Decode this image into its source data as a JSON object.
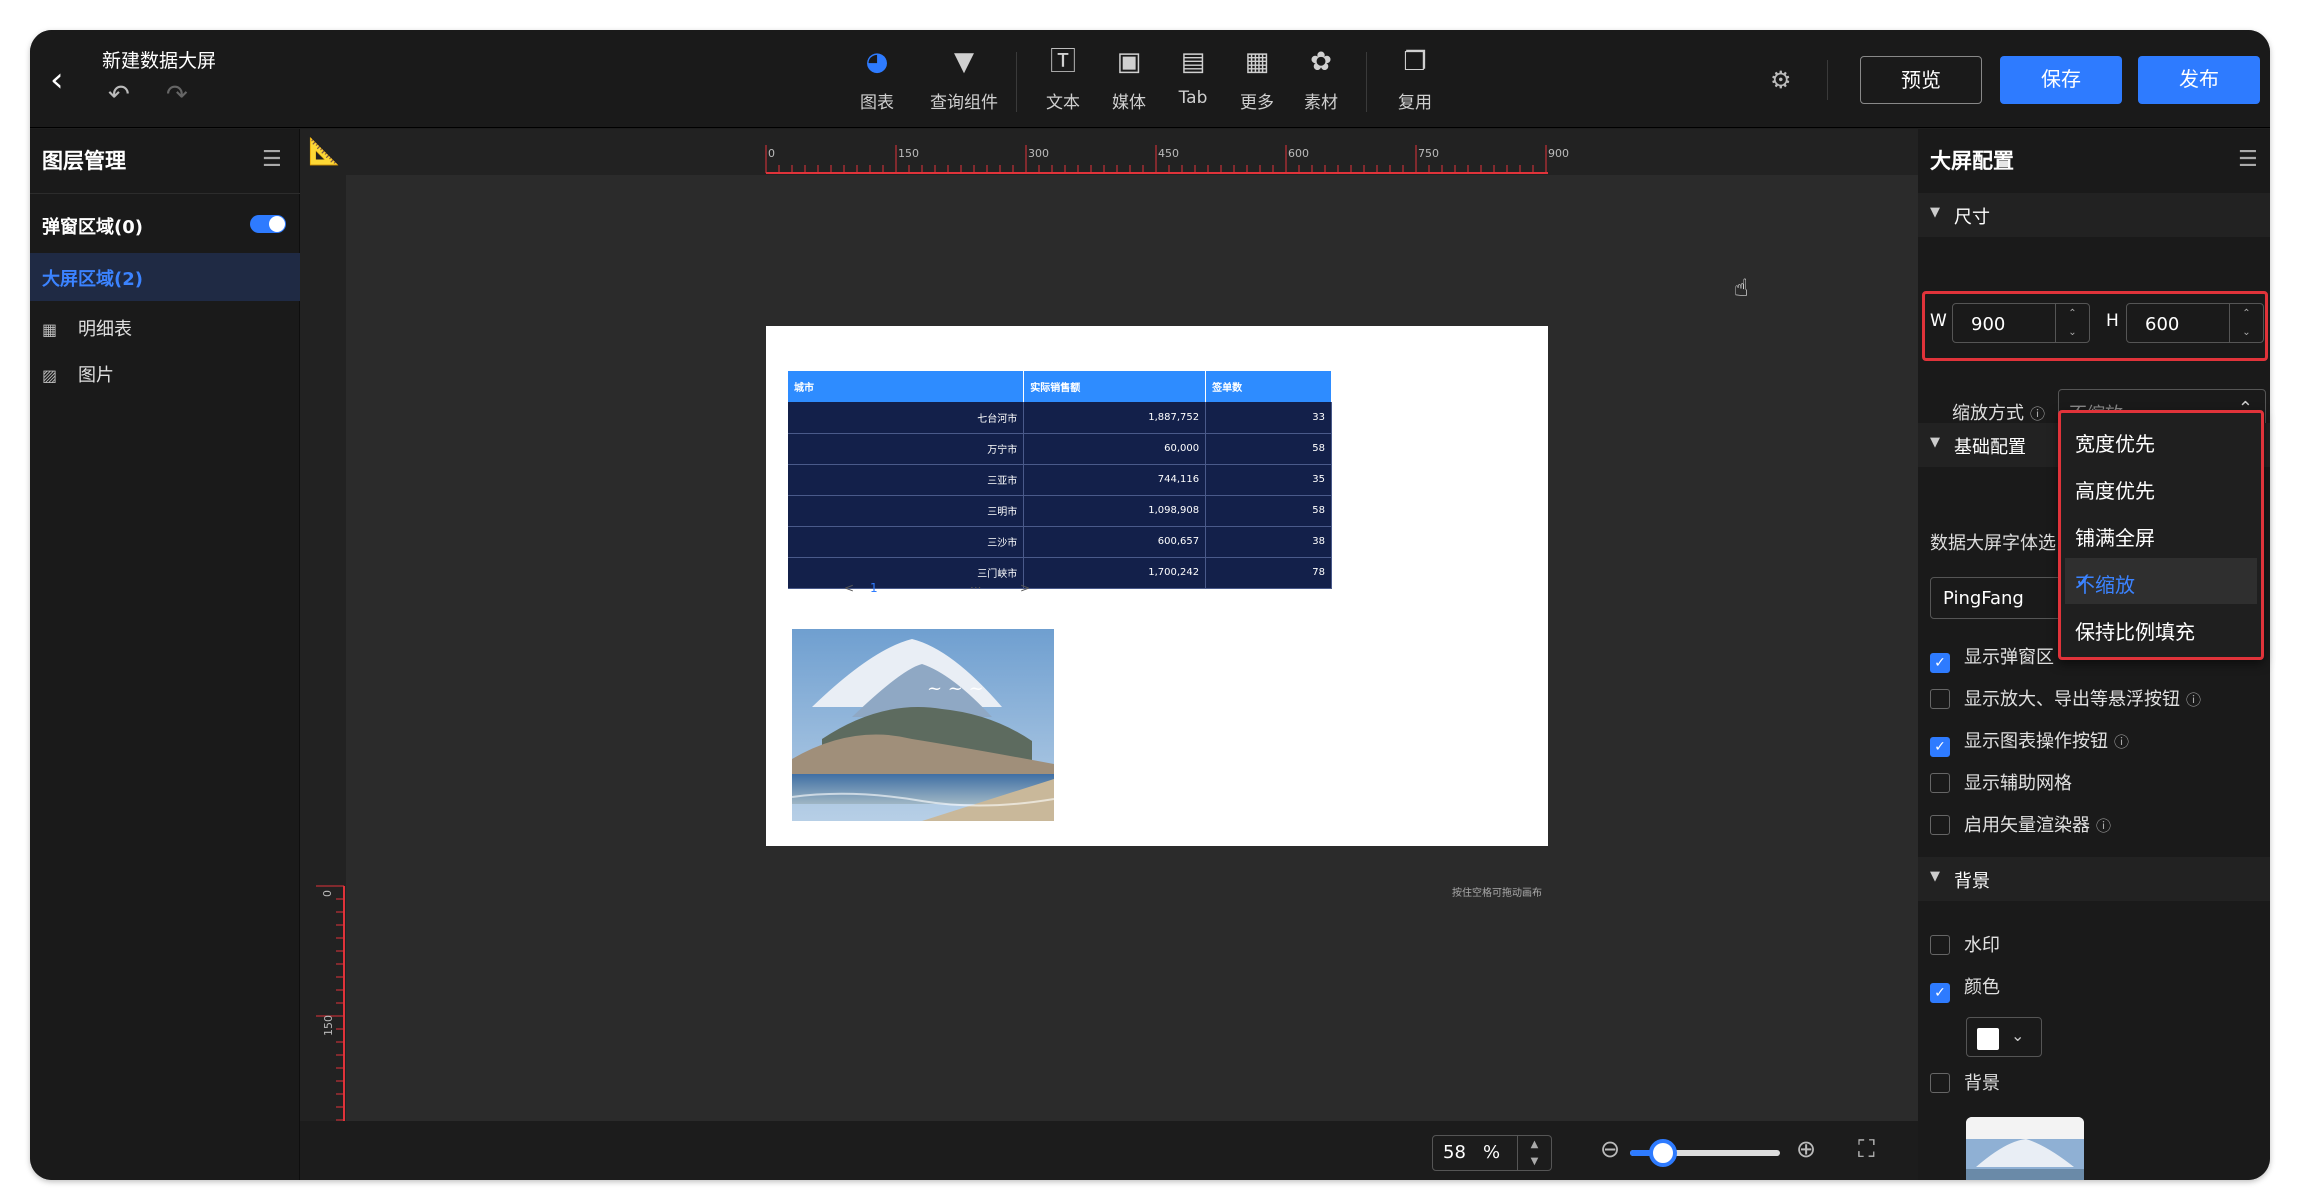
{
  "header": {
    "title": "新建数据大屏",
    "tools": [
      {
        "label": "图表",
        "icon": "pie-chart-icon"
      },
      {
        "label": "查询组件",
        "icon": "filter-icon"
      },
      {
        "label": "文本",
        "icon": "text-icon"
      },
      {
        "label": "媒体",
        "icon": "image-icon"
      },
      {
        "label": "Tab",
        "icon": "tab-icon"
      },
      {
        "label": "更多",
        "icon": "grid-icon"
      },
      {
        "label": "素材",
        "icon": "palette-icon"
      },
      {
        "label": "复用",
        "icon": "copy-icon"
      }
    ],
    "preview_label": "预览",
    "save_label": "保存",
    "publish_label": "发布"
  },
  "layers_panel": {
    "title": "图层管理",
    "popup_area": "弹窗区域(0)",
    "popup_toggle": true,
    "screen_area": "大屏区域(2)",
    "layers": [
      {
        "label": "明细表",
        "icon": "table-icon"
      },
      {
        "label": "图片",
        "icon": "image-icon"
      }
    ]
  },
  "canvas": {
    "ruler_top_labels": [
      "0",
      "150",
      "300",
      "450",
      "600",
      "750",
      "900"
    ],
    "ruler_left_labels": [
      "0",
      "150"
    ],
    "hint": "按住空格可拖动画布",
    "table": {
      "headers": [
        "城市",
        "实际销售额",
        "签单数"
      ],
      "rows": [
        [
          "七台河市",
          "1,887,752",
          "33"
        ],
        [
          "万宁市",
          "60,000",
          "58"
        ],
        [
          "三亚市",
          "744,116",
          "35"
        ],
        [
          "三明市",
          "1,098,908",
          "58"
        ],
        [
          "三沙市",
          "600,657",
          "38"
        ],
        [
          "三门峡市",
          "1,700,242",
          "78"
        ]
      ],
      "pager": {
        "prev": "<",
        "page": "1",
        "more": "···",
        "next": ">"
      }
    },
    "image_alt": "Mount Fuji coastal photo"
  },
  "zoom": {
    "value": "58",
    "unit": "%",
    "fraction": 0.22
  },
  "config_panel": {
    "title": "大屏配置",
    "size_section": "尺寸",
    "w_label": "W",
    "w_value": "900",
    "h_label": "H",
    "h_value": "600",
    "scale_label": "缩放方式",
    "scale_value": "不缩放",
    "basic_section": "基础配置",
    "font_label": "数据大屏字体选",
    "font_value": "PingFang",
    "checkboxes": [
      {
        "label": "显示弹窗区",
        "checked": true
      },
      {
        "label": "显示放大、导出等悬浮按钮",
        "checked": false
      },
      {
        "label": "显示图表操作按钮",
        "checked": true
      },
      {
        "label": "显示辅助网格",
        "checked": false
      },
      {
        "label": "启用矢量渲染器",
        "checked": false
      }
    ],
    "bg_section": "背景",
    "bg_options": [
      {
        "label": "水印",
        "checked": false
      },
      {
        "label": "颜色",
        "checked": true
      },
      {
        "label": "背景",
        "checked": false
      }
    ],
    "bg_color": "#ffffff"
  },
  "scale_dropdown": {
    "options": [
      "宽度优先",
      "高度优先",
      "铺满全屏",
      "不缩放",
      "保持比例填充"
    ],
    "selected": "不缩放"
  },
  "colors": {
    "accent": "#2e7bff",
    "highlight": "#e0333a",
    "table_header": "#2e8cff",
    "table_body": "#13204a"
  }
}
